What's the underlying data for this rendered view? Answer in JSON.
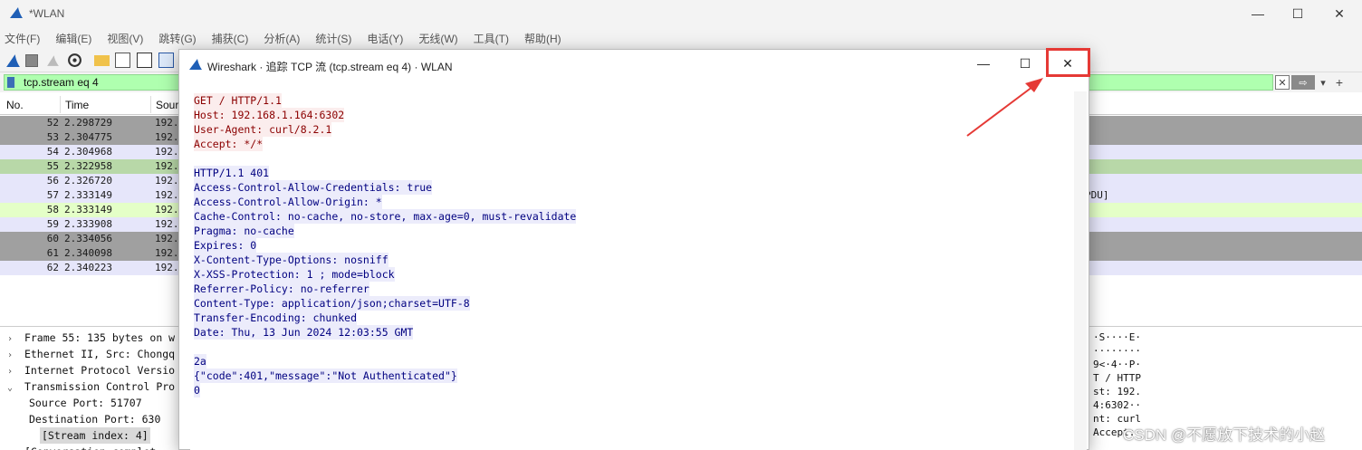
{
  "main_window": {
    "title": "*WLAN",
    "controls": {
      "minimize": "—",
      "maximize": "☐",
      "close": "✕"
    }
  },
  "menu": [
    "文件(F)",
    "编辑(E)",
    "视图(V)",
    "跳转(G)",
    "捕获(C)",
    "分析(A)",
    "统计(S)",
    "电话(Y)",
    "无线(W)",
    "工具(T)",
    "帮助(H)"
  ],
  "filter": {
    "value": "tcp.stream eq 4",
    "clear_label": "✕",
    "apply_label": "⇨",
    "dropdown_label": "▾",
    "add_label": "+"
  },
  "packet_list": {
    "columns": {
      "no": "No.",
      "time": "Time",
      "source": "Sour"
    },
    "rows": [
      {
        "no": "52",
        "time": "2.298729",
        "src": "192.",
        "info": "",
        "color": "#a0a0a0"
      },
      {
        "no": "53",
        "time": "2.304775",
        "src": "192.",
        "info": "",
        "color": "#a0a0a0"
      },
      {
        "no": "54",
        "time": "2.304968",
        "src": "192.",
        "info": "",
        "color": "#e6e6fa"
      },
      {
        "no": "55",
        "time": "2.322958",
        "src": "192.",
        "info": "",
        "color": "#b8d8a8"
      },
      {
        "no": "56",
        "time": "2.326720",
        "src": "192.",
        "info": "",
        "color": "#e6e6fa"
      },
      {
        "no": "57",
        "time": "2.333149",
        "src": "192.",
        "info": "PDU]",
        "color": "#e6e6fa"
      },
      {
        "no": "58",
        "time": "2.333149",
        "src": "192.",
        "info": "",
        "color": "#e4ffc7"
      },
      {
        "no": "59",
        "time": "2.333908",
        "src": "192.",
        "info": "",
        "color": "#e6e6fa"
      },
      {
        "no": "60",
        "time": "2.334056",
        "src": "192.",
        "info": "",
        "color": "#a0a0a0"
      },
      {
        "no": "61",
        "time": "2.340098",
        "src": "192.",
        "info": "",
        "color": "#a0a0a0"
      },
      {
        "no": "62",
        "time": "2.340223",
        "src": "192.",
        "info": "",
        "color": "#e6e6fa"
      }
    ]
  },
  "details": {
    "rows": [
      {
        "arrow": "›",
        "text": "Frame 55: 135 bytes on w",
        "selected": false
      },
      {
        "arrow": "›",
        "text": "Ethernet II, Src: Chongq",
        "selected": false
      },
      {
        "arrow": "›",
        "text": "Internet Protocol Versio",
        "selected": false
      },
      {
        "arrow": "⌄",
        "text": "Transmission Control Pro",
        "selected": false
      },
      {
        "arrow": "",
        "text": "Source Port: 51707",
        "selected": false
      },
      {
        "arrow": "",
        "text": "Destination Port: 630",
        "selected": false
      },
      {
        "arrow": "",
        "text": "[Stream index: 4]",
        "selected": true
      },
      {
        "arrow": "›",
        "text": "[Conversation complet",
        "selected": false
      }
    ],
    "hex": [
      "·S····E·",
      "········",
      "9<·4··P·",
      "T / HTTP",
      "st: 192.",
      "4:6302··",
      "nt: curl",
      "Accept: "
    ]
  },
  "dialog": {
    "title": "Wireshark · 追踪 TCP 流 (tcp.stream eq 4) · WLAN",
    "controls": {
      "minimize": "—",
      "maximize": "☐",
      "close": "✕"
    },
    "client_lines": [
      "GET / HTTP/1.1",
      "Host: 192.168.1.164:6302",
      "User-Agent: curl/8.2.1",
      "Accept: */*"
    ],
    "server_lines": [
      "HTTP/1.1 401",
      "Access-Control-Allow-Credentials: true",
      "Access-Control-Allow-Origin: *",
      "Cache-Control: no-cache, no-store, max-age=0, must-revalidate",
      "Pragma: no-cache",
      "Expires: 0",
      "X-Content-Type-Options: nosniff",
      "X-XSS-Protection: 1 ; mode=block",
      "Referrer-Policy: no-referrer",
      "Content-Type: application/json;charset=UTF-8",
      "Transfer-Encoding: chunked",
      "Date: Thu, 13 Jun 2024 12:03:55 GMT"
    ],
    "body_lines": [
      "2a",
      "{\"code\":401,\"message\":\"Not Authenticated\"}",
      "0"
    ]
  },
  "watermark": "CSDN @不愿放下技术的小赵",
  "colors": {
    "client_text": "#8b0000",
    "server_text": "#000080",
    "highlight": "#e53935",
    "filter_bg": "#afffaf"
  }
}
